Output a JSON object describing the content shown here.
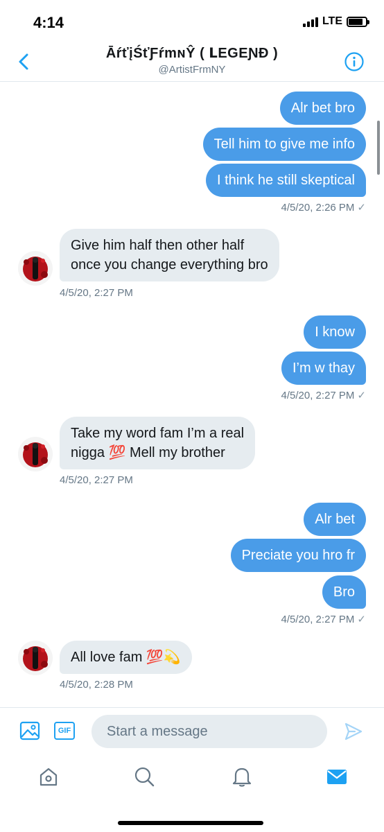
{
  "status_bar": {
    "time": "4:14",
    "network": "LTE",
    "battery_level": 0.85
  },
  "header": {
    "title": "ĀŕťįŚťƑŕmɴŶ ( ᒪEGEƝĐ )",
    "handle": "@ArtistFrmNY"
  },
  "messages": [
    {
      "direction": "out",
      "text": "Alr bet bro"
    },
    {
      "direction": "out",
      "text": "Tell him to give me info"
    },
    {
      "direction": "out",
      "text": "I think he still skeptical"
    },
    {
      "direction": "out",
      "timestamp": "4/5/20, 2:26 PM",
      "read_mark": "✓"
    },
    {
      "direction": "in",
      "lines": [
        "Give him half then other half",
        "once you change everything bro"
      ]
    },
    {
      "direction": "in",
      "timestamp": "4/5/20, 2:27 PM"
    },
    {
      "direction": "out",
      "text": "I know"
    },
    {
      "direction": "out",
      "text": "I’m w thay"
    },
    {
      "direction": "out",
      "timestamp": "4/5/20, 2:27 PM",
      "read_mark": "✓"
    },
    {
      "direction": "in",
      "lines": [
        "Take my word fam I’m a real",
        "nigga 💯 Mell my brother"
      ]
    },
    {
      "direction": "in",
      "timestamp": "4/5/20, 2:27 PM"
    },
    {
      "direction": "out",
      "text": "Alr bet"
    },
    {
      "direction": "out",
      "text": "Preciate you hro fr"
    },
    {
      "direction": "out",
      "text": "Bro"
    },
    {
      "direction": "out",
      "timestamp": "4/5/20, 2:27 PM",
      "read_mark": "✓"
    },
    {
      "direction": "in",
      "text": "All love fam 💯💫"
    },
    {
      "direction": "in",
      "timestamp": "4/5/20, 2:28 PM"
    }
  ],
  "composer": {
    "placeholder": "Start a message",
    "gif_label": "GIF"
  },
  "tabbar": {
    "tabs": [
      "home-icon",
      "search-icon",
      "bell-icon",
      "mail-icon"
    ],
    "active": "mail-icon"
  },
  "colors": {
    "accent": "#1da1f2",
    "outgoing_bubble": "#4a9ce8",
    "incoming_bubble": "#e6ecf0",
    "muted_text": "#657786"
  }
}
